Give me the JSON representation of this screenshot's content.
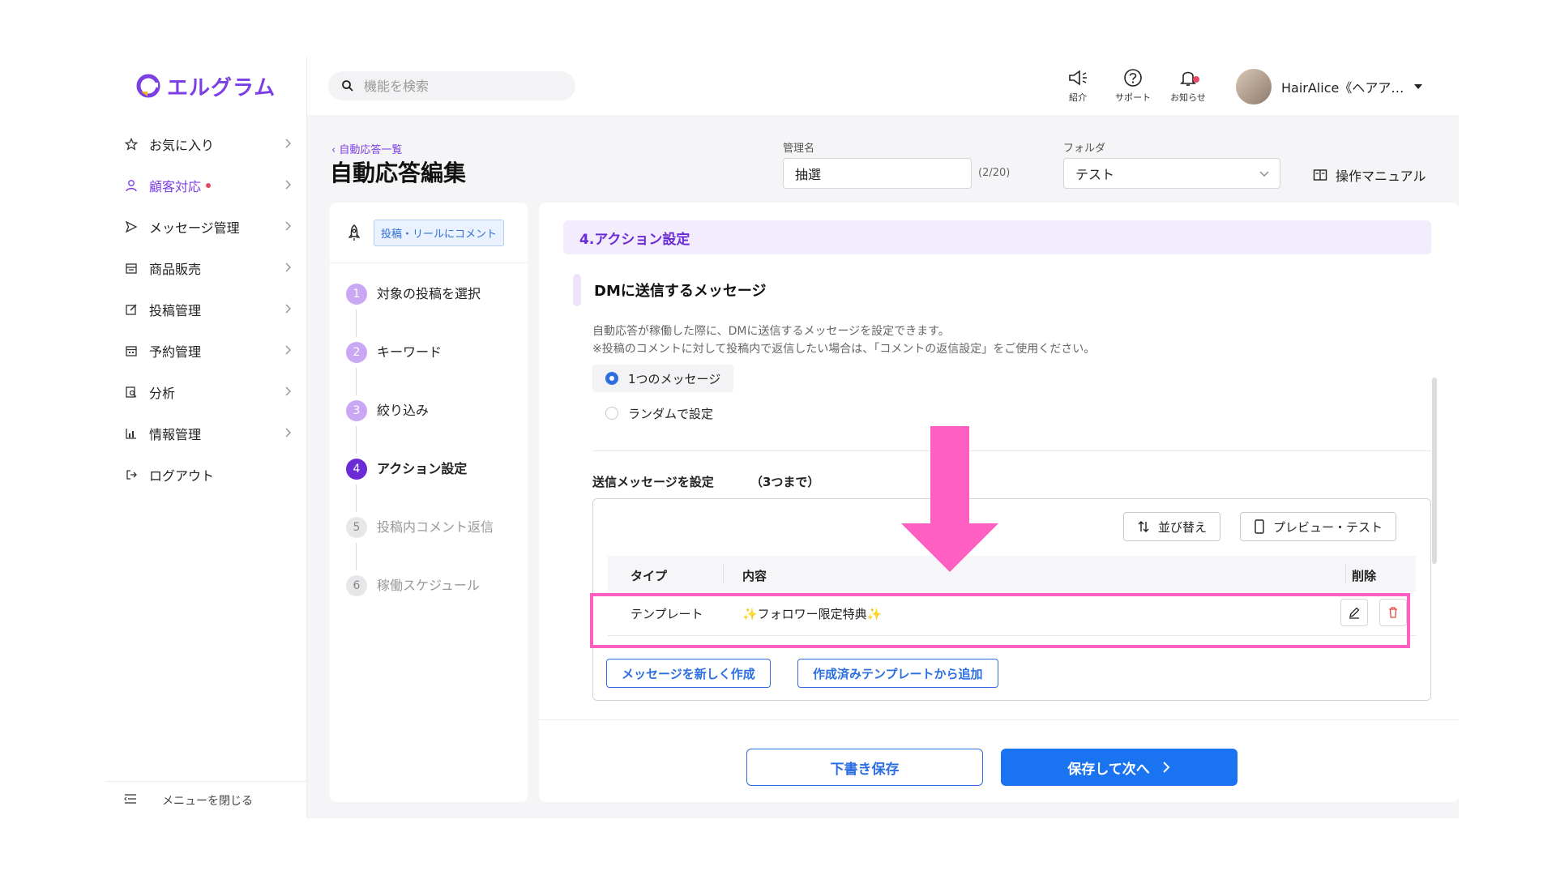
{
  "app": {
    "logo_text": "エルグラム",
    "brand_color": "#7b3fe4"
  },
  "sidebar": {
    "items": [
      {
        "label": "お気に入り",
        "icon": "star-icon"
      },
      {
        "label": "顧客対応",
        "icon": "user-icon",
        "active": true
      },
      {
        "label": "メッセージ管理",
        "icon": "send-icon"
      },
      {
        "label": "商品販売",
        "icon": "store-icon"
      },
      {
        "label": "投稿管理",
        "icon": "edit-icon"
      },
      {
        "label": "予約管理",
        "icon": "calendar-icon"
      },
      {
        "label": "分析",
        "icon": "analysis-icon"
      },
      {
        "label": "情報管理",
        "icon": "chart-icon"
      },
      {
        "label": "ログアウト",
        "icon": "logout-icon"
      }
    ],
    "footer_label": "メニューを閉じる"
  },
  "header": {
    "search_placeholder": "機能を検索",
    "icons": [
      {
        "label": "紹介",
        "icon": "megaphone-icon"
      },
      {
        "label": "サポート",
        "icon": "help-icon"
      },
      {
        "label": "お知らせ",
        "icon": "bell-icon"
      }
    ],
    "user_name": "HairAlice《ヘアア…"
  },
  "page": {
    "back_link": "自動応答一覧",
    "title": "自動応答編集",
    "name_label": "管理名",
    "name_value": "抽選",
    "name_counter": "(2/20)",
    "folder_label": "フォルダ",
    "folder_value": "テスト",
    "manual_label": "操作マニュアル"
  },
  "steps": {
    "type_tag": "投稿・リールにコメント",
    "items": [
      {
        "num": "1",
        "label": "対象の投稿を選択",
        "state": "done"
      },
      {
        "num": "2",
        "label": "キーワード",
        "state": "done"
      },
      {
        "num": "3",
        "label": "絞り込み",
        "state": "done"
      },
      {
        "num": "4",
        "label": "アクション設定",
        "state": "current"
      },
      {
        "num": "5",
        "label": "投稿内コメント返信",
        "state": "todo"
      },
      {
        "num": "6",
        "label": "稼働スケジュール",
        "state": "todo"
      }
    ]
  },
  "main": {
    "section_title": "4.アクション設定",
    "sub_title": "DMに送信するメッセージ",
    "desc1": "自動応答が稼働した際に、DMに送信するメッセージを設定できます。",
    "desc2": "※投稿のコメントに対して投稿内で返信したい場合は、「コメントの返信設定」をご使用ください。",
    "radio_single": "1つのメッセージ",
    "radio_random": "ランダムで設定",
    "set_title": "送信メッセージを設定",
    "set_limit": "（3つまで）",
    "sort_label": "並び替え",
    "preview_label": "プレビュー・テスト",
    "table": {
      "col_type": "タイプ",
      "col_content": "内容",
      "col_delete": "削除",
      "rows": [
        {
          "type": "テンプレート",
          "content": "✨フォロワー限定特典✨"
        }
      ]
    },
    "new_message_label": "メッセージを新しく作成",
    "add_template_label": "作成済みテンプレートから追加",
    "draft_label": "下書き保存",
    "next_label": "保存して次へ"
  },
  "annotation_color": "#ff5fc0"
}
